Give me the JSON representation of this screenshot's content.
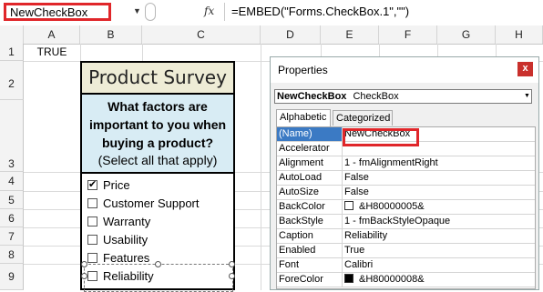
{
  "formula_bar": {
    "name_box": "NewCheckBox",
    "fx": "fx",
    "formula": "=EMBED(\"Forms.CheckBox.1\",\"\")"
  },
  "columns": [
    "A",
    "B",
    "C",
    "D",
    "E",
    "F",
    "G",
    "H"
  ],
  "rows": [
    "1",
    "2",
    "3",
    "4",
    "5",
    "6",
    "7",
    "8",
    "9"
  ],
  "cells": {
    "A1": "TRUE"
  },
  "survey": {
    "title": "Product Survey",
    "question": "What factors are important to you when buying a product?",
    "subtext": "(Select all that apply)",
    "options": [
      {
        "label": "Price",
        "checked": true,
        "mark": "✔"
      },
      {
        "label": "Customer Support",
        "checked": false,
        "mark": ""
      },
      {
        "label": "Warranty",
        "checked": false,
        "mark": ""
      },
      {
        "label": "Usability",
        "checked": false,
        "mark": ""
      },
      {
        "label": "Features",
        "checked": false,
        "mark": ""
      },
      {
        "label": "Reliability",
        "checked": false,
        "mark": ""
      }
    ]
  },
  "properties": {
    "title": "Properties",
    "close": "x",
    "object_name": "NewCheckBox",
    "object_type": "CheckBox",
    "tabs": [
      "Alphabetic",
      "Categorized"
    ],
    "rows": [
      {
        "name": "(Name)",
        "value": "NewCheckBox"
      },
      {
        "name": "Accelerator",
        "value": ""
      },
      {
        "name": "Alignment",
        "value": "1 - fmAlignmentRight"
      },
      {
        "name": "AutoLoad",
        "value": "False"
      },
      {
        "name": "AutoSize",
        "value": "False"
      },
      {
        "name": "BackColor",
        "value": "&H80000005&",
        "swatch": "#ffffff"
      },
      {
        "name": "BackStyle",
        "value": "1 - fmBackStyleOpaque"
      },
      {
        "name": "Caption",
        "value": "Reliability"
      },
      {
        "name": "Enabled",
        "value": "True"
      },
      {
        "name": "Font",
        "value": "Calibri"
      },
      {
        "name": "ForeColor",
        "value": "&H80000008&",
        "swatch": "#000000"
      }
    ]
  },
  "colors": {
    "highlight": "#e0262a",
    "title_bg": "#eeecd6",
    "question_bg": "#d8ecf4",
    "selected_row": "#3b7ac4"
  }
}
